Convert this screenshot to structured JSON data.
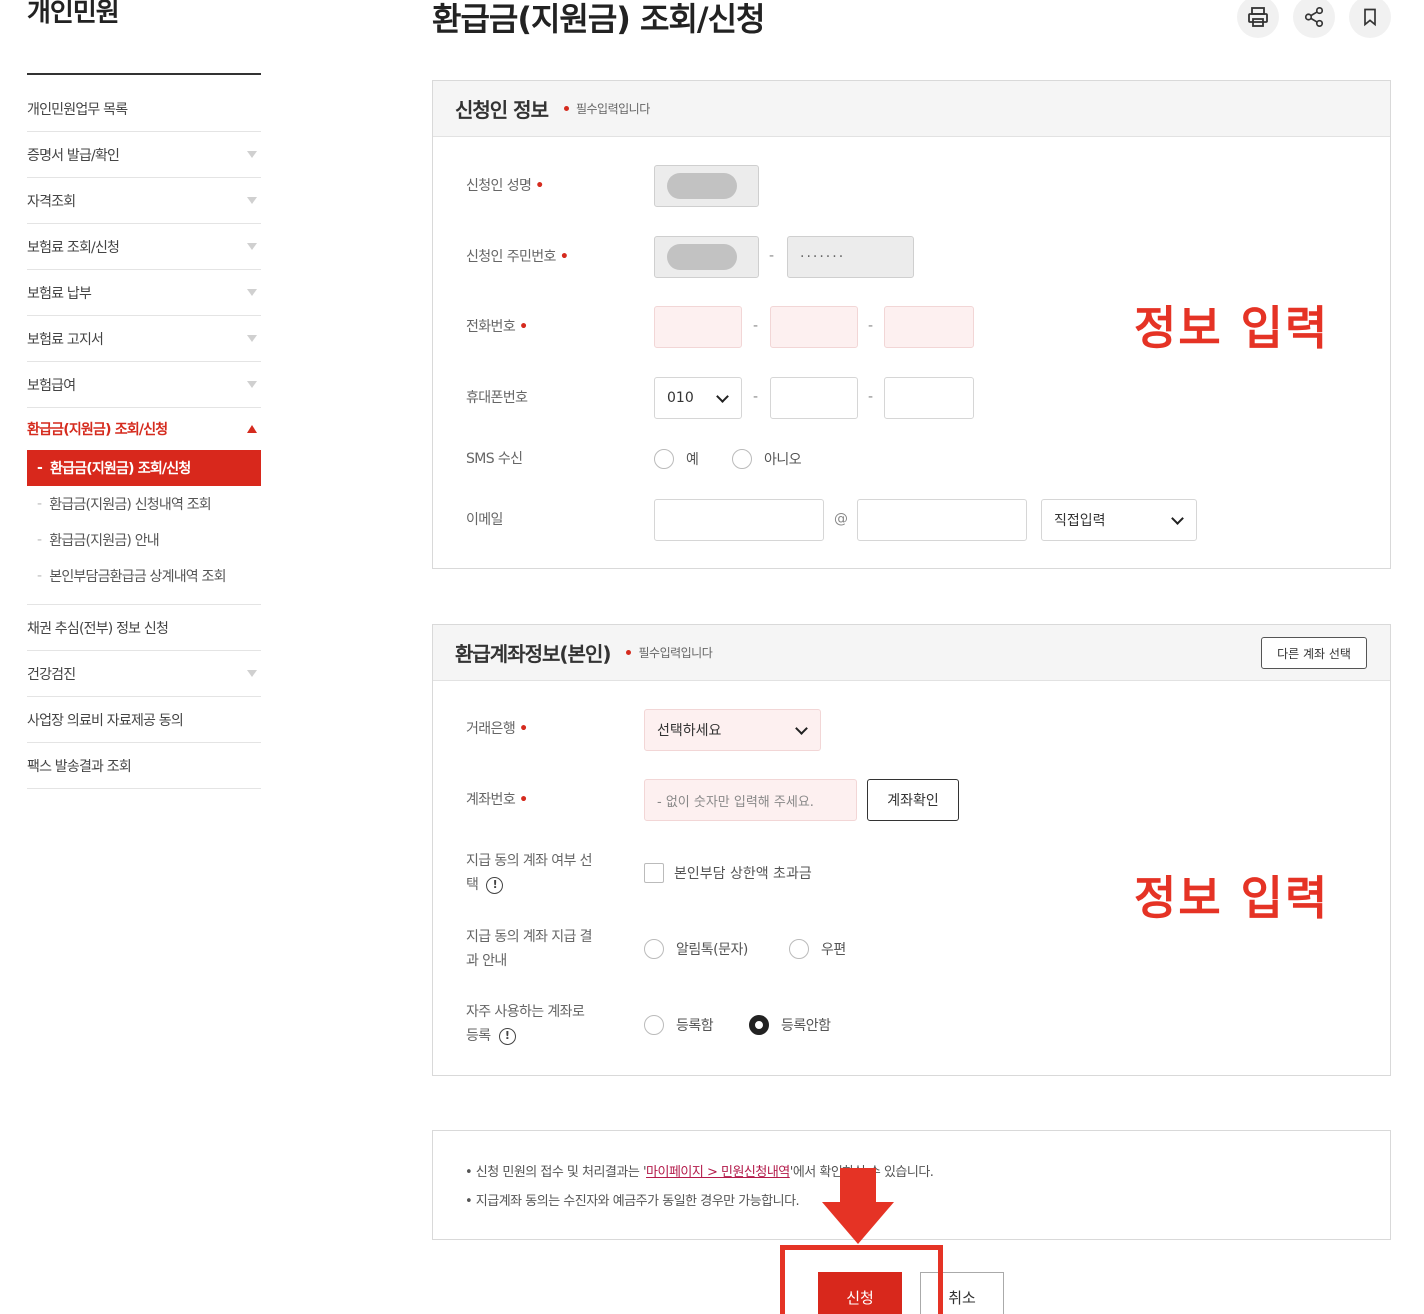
{
  "sidebar": {
    "title": "개인민원",
    "items": [
      {
        "label": "개인민원업무 목록"
      },
      {
        "label": "증명서 발급/확인"
      },
      {
        "label": "자격조회"
      },
      {
        "label": "보험료 조회/신청"
      },
      {
        "label": "보험료 납부"
      },
      {
        "label": "보험료 고지서"
      },
      {
        "label": "보험급여"
      },
      {
        "label": "환급금(지원금) 조회/신청"
      }
    ],
    "sub_items": [
      {
        "label": "환급금(지원금) 조회/신청"
      },
      {
        "label": "환급금(지원금) 신청내역 조회"
      },
      {
        "label": "환급금(지원금) 안내"
      },
      {
        "label": "본인부담금환급금 상계내역 조회"
      }
    ],
    "items_after": [
      {
        "label": "채권 추심(전부) 정보 신청"
      },
      {
        "label": "건강검진"
      },
      {
        "label": "사업장 의료비 자료제공 동의"
      },
      {
        "label": "팩스 발송결과 조회"
      }
    ]
  },
  "header": {
    "title": "환급금(지원금) 조회/신청"
  },
  "applicant": {
    "title": "신청인 정보",
    "required_note": "필수입력입니다",
    "name_label": "신청인 성명",
    "rrn_label": "신청인 주민번호",
    "rrn_back": "·······",
    "phone_label": "전화번호",
    "mobile_label": "휴대폰번호",
    "mobile_prefix": "010",
    "sms_label": "SMS 수신",
    "sms_yes": "예",
    "sms_no": "아니오",
    "email_label": "이메일",
    "email_at": "@",
    "email_domain_select": "직접입력"
  },
  "account": {
    "title": "환급계좌정보(본인)",
    "required_note": "필수입력입니다",
    "other_account_button": "다른 계좌 선택",
    "bank_label": "거래은행",
    "bank_select": "선택하세요",
    "account_label": "계좌번호",
    "account_placeholder": "- 없이 숫자만 입력해 주세요.",
    "verify_button": "계좌확인",
    "consent_select_label_1": "지급 동의 계좌 여부 선",
    "consent_select_label_2": "택",
    "consent_checkbox": "본인부담 상한액 초과금",
    "consent_notice_label_1": "지급 동의 계좌 지급 결",
    "consent_notice_label_2": "과 안내",
    "notice_opt_1": "알림톡(문자)",
    "notice_opt_2": "우편",
    "frequent_label_1": "자주 사용하는 계좌로",
    "frequent_label_2": "등록",
    "frequent_opt_1": "등록함",
    "frequent_opt_2": "등록안함"
  },
  "overlays": {
    "info_input_1": "정보 입력",
    "info_input_2": "정보 입력"
  },
  "notice": {
    "line1_prefix": "• 신청 민원의 접수 및 처리결과는 '",
    "line1_link": "마이페이지 > 민원신청내역",
    "line1_suffix": "'에서 확인하실 수 있습니다.",
    "line2": "• 지급계좌 동의는 수진자와 예금주가 동일한 경우만 가능합니다."
  },
  "actions": {
    "submit": "신청",
    "cancel": "취소"
  },
  "colors": {
    "accent": "#d8281c",
    "overlay_red": "#e53325"
  }
}
